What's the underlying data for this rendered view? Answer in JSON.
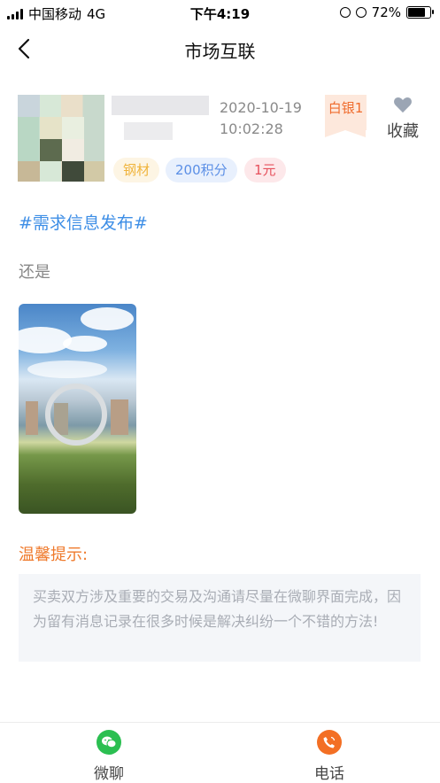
{
  "status_bar": {
    "carrier": "中国移动",
    "network": "4G",
    "time": "下午4:19",
    "battery": "72%",
    "battery_level": 0.72
  },
  "nav": {
    "title": "市场互联",
    "back_icon": "back-arrow-icon"
  },
  "post": {
    "date": "2020-10-19",
    "time": "10:02:28",
    "rank_badge": "白银1",
    "favorite_label": "收藏",
    "tags": [
      "钢材",
      "200积分",
      "1元"
    ],
    "topic": "#需求信息发布#",
    "content": "还是"
  },
  "tips": {
    "title": "温馨提示:",
    "text": "买卖双方涉及重要的交易及沟通请尽量在微聊界面完成，因为留有消息记录在很多时候是解决纠纷一个不错的方法!"
  },
  "bottom_bar": {
    "chat_label": "微聊",
    "phone_label": "电话"
  },
  "colors": {
    "accent_blue": "#3d8ee6",
    "tip_orange": "#ef7a2c",
    "wechat_green": "#2bbf51",
    "phone_orange": "#f36f24"
  }
}
